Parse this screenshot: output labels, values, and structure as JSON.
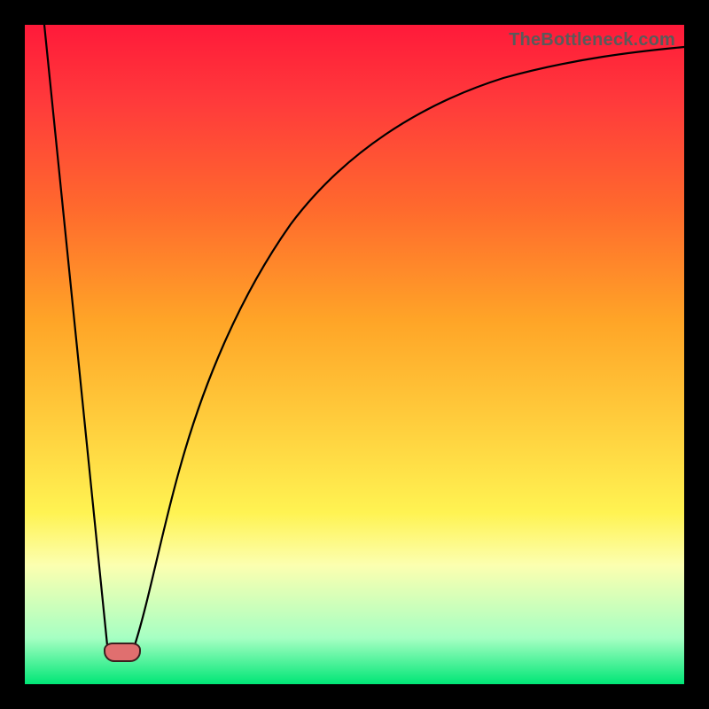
{
  "watermark": "TheBottleneck.com",
  "chart_data": {
    "type": "line",
    "title": "",
    "xlabel": "",
    "ylabel": "",
    "xlim": [
      0,
      100
    ],
    "ylim": [
      0,
      100
    ],
    "grid": false,
    "legend": false,
    "series": [
      {
        "name": "bottleneck-curve",
        "x": [
          3,
          12,
          14.5,
          17,
          22,
          30,
          40,
          52,
          65,
          80,
          100
        ],
        "y": [
          100,
          6,
          5,
          6,
          28,
          55,
          72,
          82,
          88,
          92,
          95
        ]
      }
    ],
    "marker": {
      "name": "optimal-point",
      "x": 14.5,
      "y": 5,
      "color": "#e06f6f"
    },
    "background_gradient": {
      "top": "#ff1a3a",
      "bottom": "#00e676"
    }
  }
}
